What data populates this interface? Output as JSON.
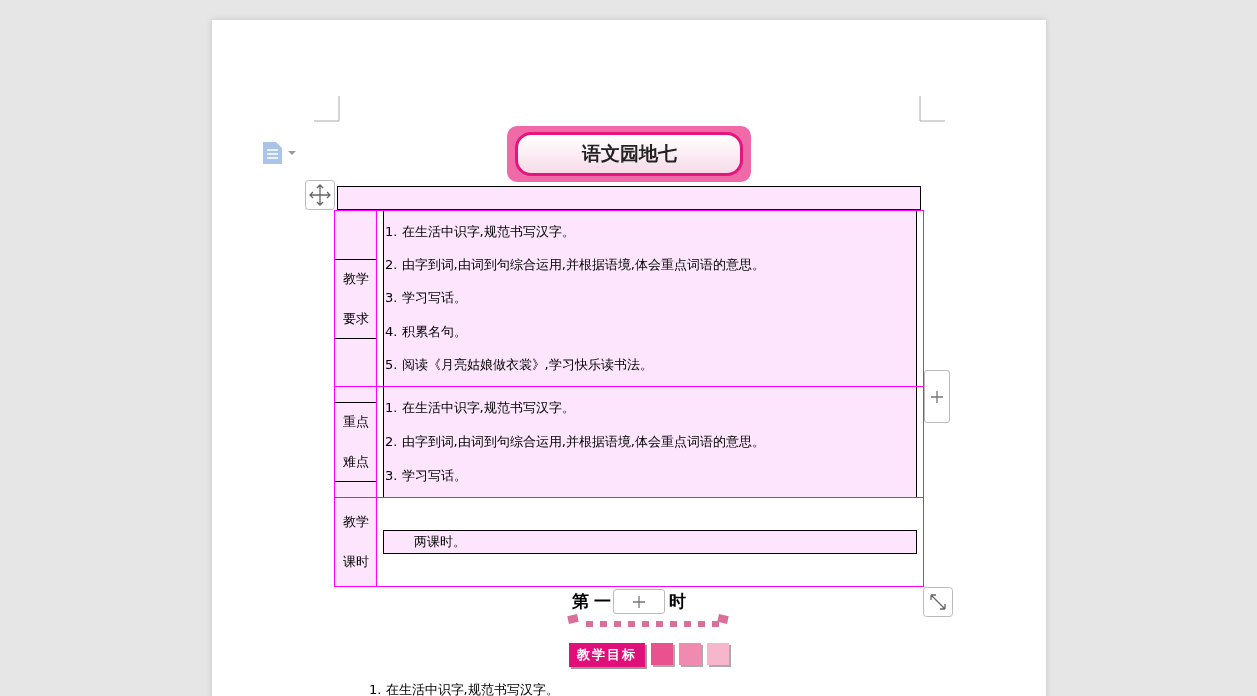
{
  "title_banner": "语文园地七",
  "table": {
    "rows": [
      {
        "kind": "list",
        "label": [
          "教学",
          "要求"
        ],
        "items": [
          "1. 在生活中识字,规范书写汉字。",
          "2. 由字到词,由词到句综合运用,并根据语境,体会重点词语的意思。",
          "3. 学习写话。",
          "4. 积累名句。",
          "5. 阅读《月亮姑娘做衣裳》,学习快乐读书法。"
        ]
      },
      {
        "kind": "list",
        "label": [
          "重点",
          "难点"
        ],
        "items": [
          "1. 在生活中识字,规范书写汉字。",
          "2. 由字到词,由词到句综合运用,并根据语境,体会重点词语的意思。",
          "3. 学习写话。"
        ]
      },
      {
        "kind": "box",
        "label": [
          "教学",
          "课时"
        ],
        "items": [
          "两课时。"
        ]
      }
    ]
  },
  "section": {
    "heading_start": "第 一",
    "heading_end": "时",
    "tag": "教学目标"
  },
  "body": [
    "1. 在生活中识字,规范书写汉字。"
  ]
}
